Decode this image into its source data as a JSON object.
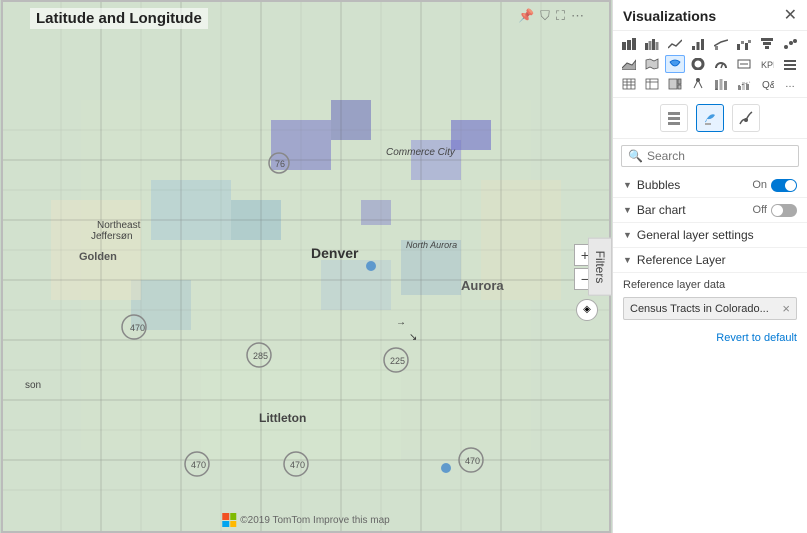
{
  "panel": {
    "title": "Visualizations",
    "close_label": "✕",
    "search_placeholder": "Search",
    "format_icons": [
      {
        "name": "grid-icon",
        "char": "⊞",
        "active": false
      },
      {
        "name": "format-icon",
        "char": "🖌",
        "active": true
      },
      {
        "name": "analytics-icon",
        "char": "∿",
        "active": false
      }
    ],
    "sections": [
      {
        "label": "Bubbles",
        "toggle": "On",
        "toggle_on": true
      },
      {
        "label": "Bar chart",
        "toggle": "Off",
        "toggle_on": false
      },
      {
        "label": "General layer settings",
        "toggle": null
      },
      {
        "label": "Reference Layer",
        "toggle": null
      }
    ],
    "reference_layer": {
      "title": "Reference Layer",
      "data_label": "Reference layer data",
      "tag_text": "Census Tracts in Colorado...",
      "revert_label": "Revert to default"
    }
  },
  "map": {
    "title": "Latitude and Longitude",
    "toolbar_icons": [
      "📌",
      "⛉",
      "⛶",
      "⋯"
    ],
    "filters_label": "Filters",
    "zoom_in": "+",
    "zoom_out": "−",
    "footer_text": "©2019 TomTom  Improve this map"
  },
  "vis_icons_row1": [
    "▦",
    "▨",
    "▩",
    "▤",
    "▥",
    "▧",
    "▪",
    "▫"
  ],
  "vis_icons_row2": [
    "↗",
    "⬛",
    "▲",
    "⬟",
    "⬡",
    "⬢",
    "⬣",
    "▮"
  ],
  "vis_icons_row3": [
    "⊞",
    "⊟",
    "⊠",
    "⊡",
    "⬚",
    "⬛",
    "⬜",
    "⬝"
  ],
  "vis_icons_row4": [
    "💬",
    "🗺",
    "📊",
    "⋯",
    "",
    "",
    "",
    ""
  ]
}
